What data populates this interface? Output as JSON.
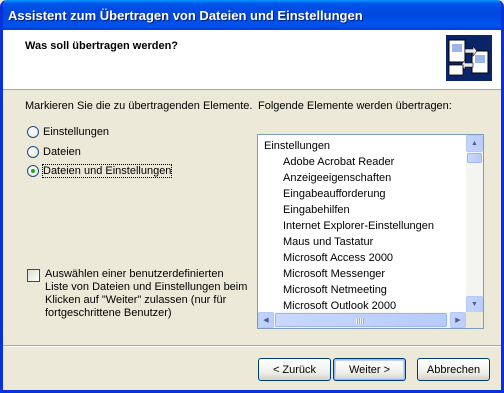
{
  "window": {
    "title": "Assistent zum Übertragen von Dateien und Einstellungen"
  },
  "header": {
    "heading": "Was soll übertragen werden?"
  },
  "left": {
    "label": "Markieren Sie die zu übertragenden Elemente.",
    "options": [
      {
        "label": "Einstellungen",
        "selected": false
      },
      {
        "label": "Dateien",
        "selected": false
      },
      {
        "label": "Dateien und Einstellungen",
        "selected": true
      }
    ],
    "custom_checkbox": {
      "checked": false,
      "label": "Auswählen einer benutzerdefinierten Liste von Dateien und Einstellungen beim Klicken auf \"Weiter\" zulassen (nur für fortgeschrittene Benutzer)"
    }
  },
  "right": {
    "label": "Folgende Elemente werden übertragen:",
    "list_header": "Einstellungen",
    "items": [
      "Adobe Acrobat Reader",
      "Anzeigeeigenschaften",
      "Eingabeaufforderung",
      "Eingabehilfen",
      "Internet Explorer-Einstellungen",
      "Maus und Tastatur",
      "Microsoft Access 2000",
      "Microsoft Messenger",
      "Microsoft Netmeeting",
      "Microsoft Outlook 2000"
    ]
  },
  "buttons": {
    "back": "< Zurück",
    "next": "Weiter >",
    "cancel": "Abbrechen"
  },
  "colors": {
    "title_bar": "#0054e3",
    "face": "#ece9d8",
    "radio_dot": "#21a121"
  }
}
